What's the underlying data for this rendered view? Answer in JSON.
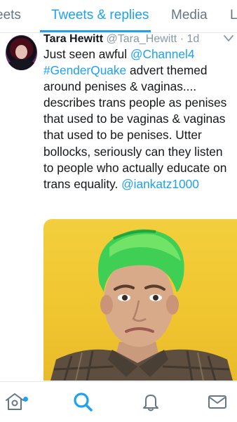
{
  "tabs": [
    {
      "label": "Tweets",
      "visible_text": "eets",
      "active": false
    },
    {
      "label": "Tweets & replies",
      "active": true
    },
    {
      "label": "Media",
      "active": false
    },
    {
      "label": "Likes",
      "visible_text": "L",
      "active": false
    }
  ],
  "tweet": {
    "author_name": "Tara Hewitt",
    "handle": "@Tara_Hewitt",
    "separator": "·",
    "time": "1d",
    "text_parts": [
      {
        "text": "Just seen awful ",
        "link": false
      },
      {
        "text": "@Channel4",
        "link": true
      },
      {
        "text": " ",
        "link": false
      },
      {
        "text": "#GenderQuake",
        "link": true
      },
      {
        "text": " advert themed around penises & vaginas.... describes trans people as penises that used to be vaginas & vaginas that used to be penises. Utter bollocks, seriously can they listen to people who actually educate on trans equality. ",
        "link": false
      },
      {
        "text": "@iankatz1000",
        "link": true
      }
    ],
    "media": {
      "type": "photo",
      "description_icon": "person-photo"
    }
  },
  "bottom_nav": [
    {
      "icon": "home-icon",
      "active": false,
      "has_notification_dot": true
    },
    {
      "icon": "search-icon",
      "active": true
    },
    {
      "icon": "bell-icon",
      "active": false
    },
    {
      "icon": "mail-icon",
      "active": false
    }
  ],
  "colors": {
    "accent": "#1da1f2",
    "text": "#14171a",
    "secondary": "#8899a6",
    "media_background": "#f0c52f",
    "hair": "#3fcf55"
  }
}
